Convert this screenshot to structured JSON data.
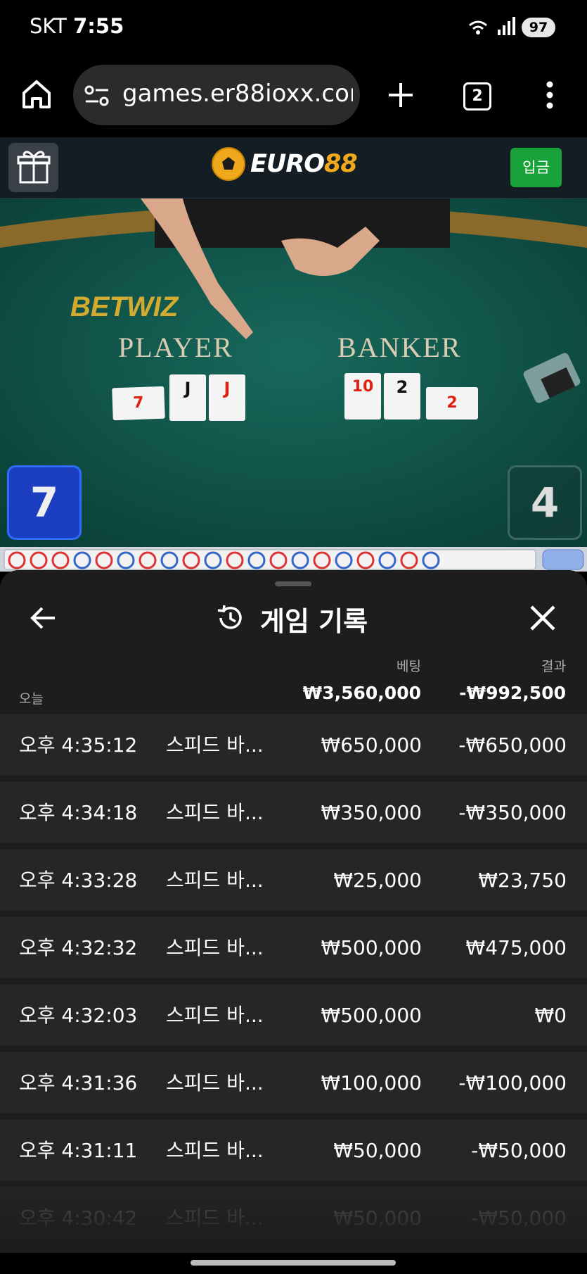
{
  "status_bar": {
    "carrier": "SKT",
    "time": "7:55",
    "battery": "97"
  },
  "browser": {
    "url": "games.er88ioxx.com",
    "tab_count": "2"
  },
  "site": {
    "logo_part1": "EURO",
    "logo_part2": "88",
    "deposit_label": "입금"
  },
  "video": {
    "table_brand": "BETWIZ",
    "player_label": "PLAYER",
    "banker_label": "BANKER",
    "player_score": "7",
    "banker_score": "4",
    "player_cards": [
      "7",
      "J",
      "J"
    ],
    "banker_cards": [
      "10",
      "2",
      "2"
    ]
  },
  "sheet": {
    "title": "게임 기록",
    "bet_header": "베팅",
    "result_header": "결과",
    "today_label": "오늘",
    "total_bet": "₩3,560,000",
    "total_result": "-₩992,500",
    "rows": [
      {
        "time": "오후 4:35:12",
        "game": "스피드 바...",
        "bet": "₩650,000",
        "result": "-₩650,000"
      },
      {
        "time": "오후 4:34:18",
        "game": "스피드 바...",
        "bet": "₩350,000",
        "result": "-₩350,000"
      },
      {
        "time": "오후 4:33:28",
        "game": "스피드 바...",
        "bet": "₩25,000",
        "result": "₩23,750"
      },
      {
        "time": "오후 4:32:32",
        "game": "스피드 바...",
        "bet": "₩500,000",
        "result": "₩475,000"
      },
      {
        "time": "오후 4:32:03",
        "game": "스피드 바...",
        "bet": "₩500,000",
        "result": "₩0"
      },
      {
        "time": "오후 4:31:36",
        "game": "스피드 바...",
        "bet": "₩100,000",
        "result": "-₩100,000"
      },
      {
        "time": "오후 4:31:11",
        "game": "스피드 바...",
        "bet": "₩50,000",
        "result": "-₩50,000"
      },
      {
        "time": "오후 4:30:42",
        "game": "스피드 바...",
        "bet": "₩50,000",
        "result": "-₩50,000"
      }
    ]
  }
}
